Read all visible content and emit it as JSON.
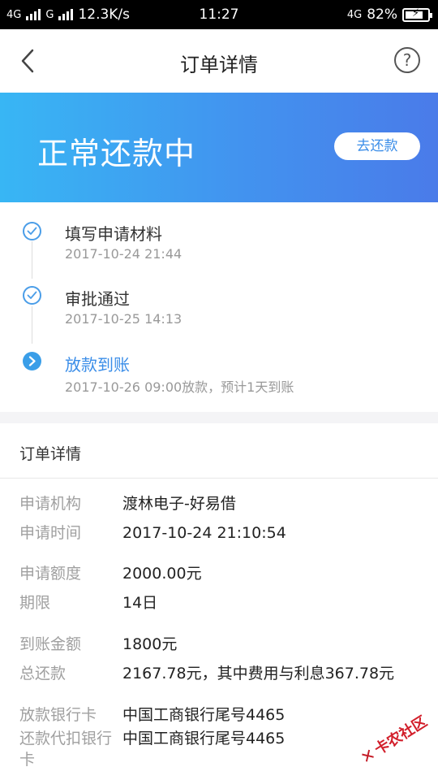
{
  "status_bar": {
    "network1": "4G",
    "network2": "G",
    "speed": "12.3K/s",
    "time": "11:27",
    "network3": "4G",
    "battery": "82%",
    "battery_level": 0.82
  },
  "nav": {
    "title": "订单详情",
    "help": "?"
  },
  "hero": {
    "status": "正常还款中",
    "repay_button": "去还款"
  },
  "timeline": [
    {
      "title": "填写申请材料",
      "time": "2017-10-24 21:44",
      "state": "done"
    },
    {
      "title": "审批通过",
      "time": "2017-10-25 14:13",
      "state": "done"
    },
    {
      "title": "放款到账",
      "time": "2017-10-26 09:00放款，预计1天到账",
      "state": "current"
    }
  ],
  "details": {
    "header": "订单详情",
    "rows": [
      {
        "label": "申请机构",
        "value": "渡林电子-好易借"
      },
      {
        "label": "申请时间",
        "value": "2017-10-24 21:10:54"
      },
      {
        "label": "申请额度",
        "value": "2000.00元"
      },
      {
        "label": "期限",
        "value": "14日"
      },
      {
        "label": "到账金额",
        "value": "1800元"
      },
      {
        "label": "总还款",
        "value": "2167.78元，其中费用与利息367.78元"
      },
      {
        "label": "放款银行卡",
        "value": "中国工商银行尾号4465"
      },
      {
        "label": "还款代扣银行卡",
        "value": "中国工商银行尾号4465"
      }
    ]
  },
  "watermark": {
    "text": "卡农社区"
  },
  "colors": {
    "accent": "#3a8de8",
    "hero_start": "#38b6f4",
    "hero_end": "#4a7be9"
  }
}
